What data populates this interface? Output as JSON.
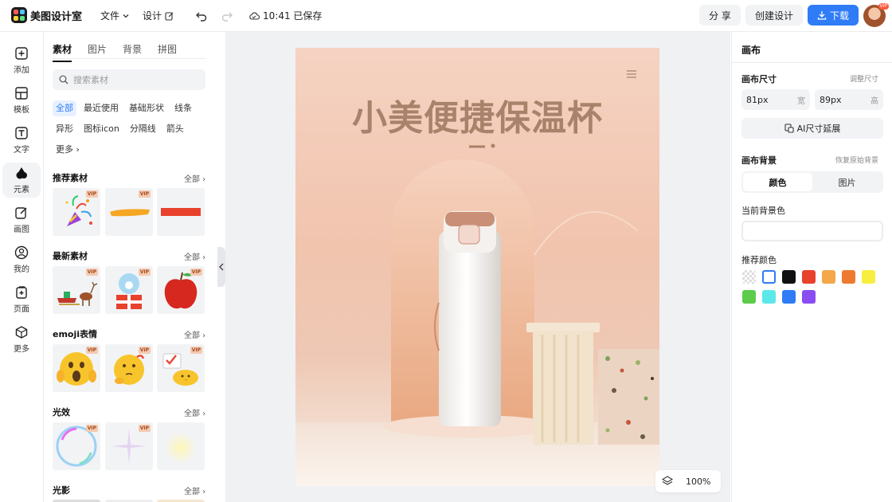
{
  "header": {
    "app_name": "美图设计室",
    "menu_file": "文件",
    "menu_design": "设计",
    "save_status": "10:41 已保存",
    "share_label": "分 享",
    "create_label": "创建设计",
    "download_label": "下载",
    "avatar_badge": "VIP"
  },
  "leftnav": {
    "items": [
      {
        "label": "添加",
        "icon": "plus-square-icon"
      },
      {
        "label": "模板",
        "icon": "template-grid-icon"
      },
      {
        "label": "文字",
        "icon": "text-t-icon"
      },
      {
        "label": "元素",
        "icon": "shapes-icon"
      },
      {
        "label": "画图",
        "icon": "pencil-edit-icon"
      },
      {
        "label": "我的",
        "icon": "user-icon"
      },
      {
        "label": "页面",
        "icon": "page-add-icon"
      },
      {
        "label": "更多",
        "icon": "cube-icon"
      }
    ],
    "active": "元素"
  },
  "materials": {
    "tabs": [
      "素材",
      "图片",
      "背景",
      "拼图"
    ],
    "active_tab": "素材",
    "search_placeholder": "搜索素材",
    "chips": [
      "全部",
      "最近使用",
      "基础形状",
      "线条",
      "异形",
      "图标icon",
      "分隔线",
      "箭头",
      "更多"
    ],
    "active_chip": "全部",
    "all_label": "全部",
    "vip_label": "VIP",
    "sections": [
      {
        "title": "推荐素材",
        "items": [
          "party-popper",
          "yellow-brush-stroke",
          "red-rectangle"
        ]
      },
      {
        "title": "最新素材",
        "items": [
          "reindeer-sleigh",
          "snow-globe-gift",
          "red-apple"
        ]
      },
      {
        "title": "emoji表情",
        "items": [
          "scared-emoji",
          "thinking-emoji",
          "checklist-chick-emoji"
        ]
      },
      {
        "title": "光效",
        "items": [
          "rainbow-bubble",
          "purple-sparkle",
          "yellow-glow"
        ]
      },
      {
        "title": "光影",
        "items": []
      }
    ]
  },
  "canvas": {
    "title_text": "小美便捷保温杯",
    "zoom": "100%"
  },
  "right_panel": {
    "title": "画布",
    "size_label": "画布尺寸",
    "adjust_size": "调整尺寸",
    "width_value": "81px",
    "width_unit": "宽",
    "height_value": "89px",
    "height_unit": "高",
    "ai_extend": "AI尺寸延展",
    "bg_label": "画布背景",
    "restore_bg": "恢复原始背景",
    "seg_color": "颜色",
    "seg_image": "图片",
    "current_bg_label": "当前背景色",
    "recommended_label": "推荐颜色",
    "colors": [
      "transparent",
      "#ffffff",
      "#111111",
      "#e8412c",
      "#f4a84a",
      "#ee7a2f",
      "#f7ef3f",
      "#5ccc4a",
      "#5ce8e8",
      "#2f7cf6",
      "#8a4df2"
    ]
  }
}
